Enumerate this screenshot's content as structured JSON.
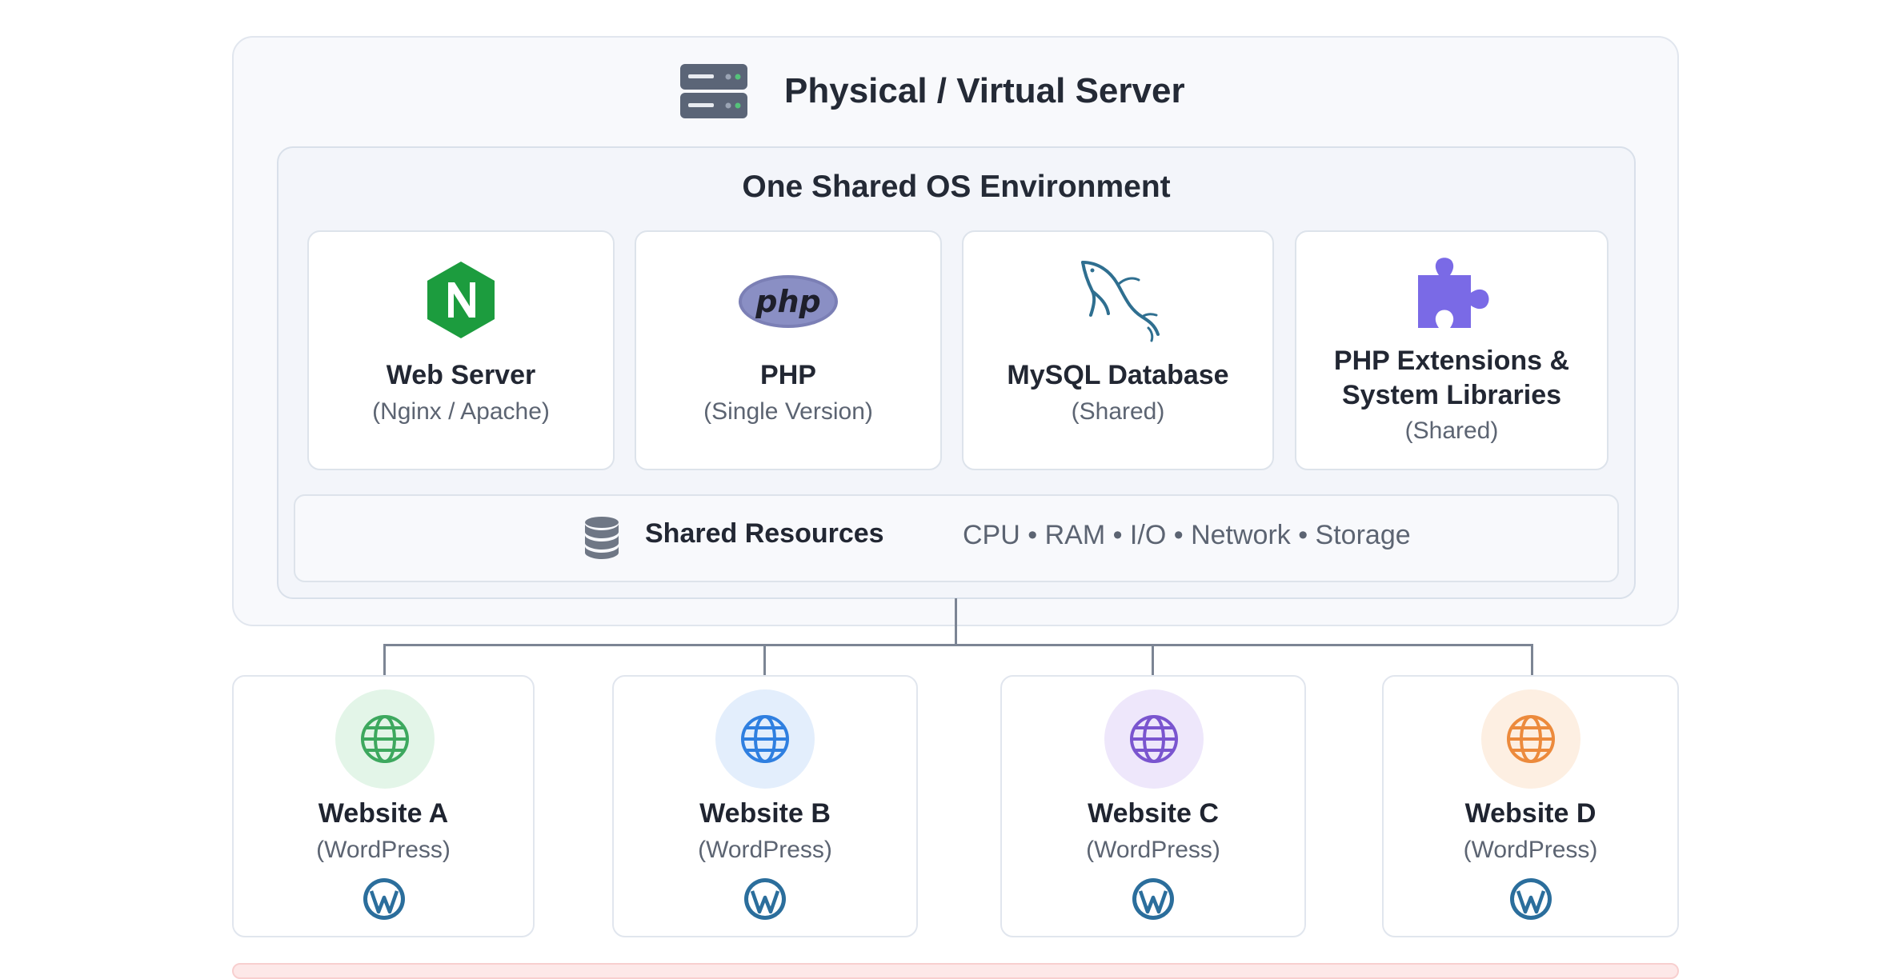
{
  "server": {
    "title": "Physical / Virtual Server",
    "icon": "server-icon"
  },
  "os": {
    "title": "One Shared OS Environment",
    "components": [
      {
        "title": "Web Server",
        "subtitle": "(Nginx / Apache)",
        "icon": "nginx-icon",
        "color": "#1c9c3e"
      },
      {
        "title": "PHP",
        "subtitle": "(Single Version)",
        "icon": "php-icon",
        "icon_text": "php",
        "color": "#7b7fb5"
      },
      {
        "title": "MySQL Database",
        "subtitle": "(Shared)",
        "icon": "mysql-dolphin-icon",
        "color": "#2f6f90"
      },
      {
        "title": "PHP Extensions &",
        "title_line2": "System Libraries",
        "subtitle": "(Shared)",
        "icon": "puzzle-icon",
        "color": "#7a6ae6"
      }
    ],
    "resources": {
      "label": "Shared Resources",
      "icon": "database-icon",
      "items": [
        "CPU",
        "RAM",
        "I/O",
        "Network",
        "Storage"
      ],
      "items_text": "CPU • RAM • I/O • Network • Storage"
    }
  },
  "websites": [
    {
      "name": "Website A",
      "platform": "(WordPress)",
      "icon": "globe-icon",
      "color": "#3da85e",
      "bg": "#e3f5e8"
    },
    {
      "name": "Website B",
      "platform": "(WordPress)",
      "icon": "globe-icon",
      "color": "#2f7fe0",
      "bg": "#e3eefc"
    },
    {
      "name": "Website C",
      "platform": "(WordPress)",
      "icon": "globe-icon",
      "color": "#7a55cf",
      "bg": "#eee7fb"
    },
    {
      "name": "Website D",
      "platform": "(WordPress)",
      "icon": "globe-icon",
      "color": "#ec8a3c",
      "bg": "#fdefe2"
    }
  ],
  "wordpress_icon": "wordpress-icon",
  "wordpress_color": "#2b6e9c"
}
